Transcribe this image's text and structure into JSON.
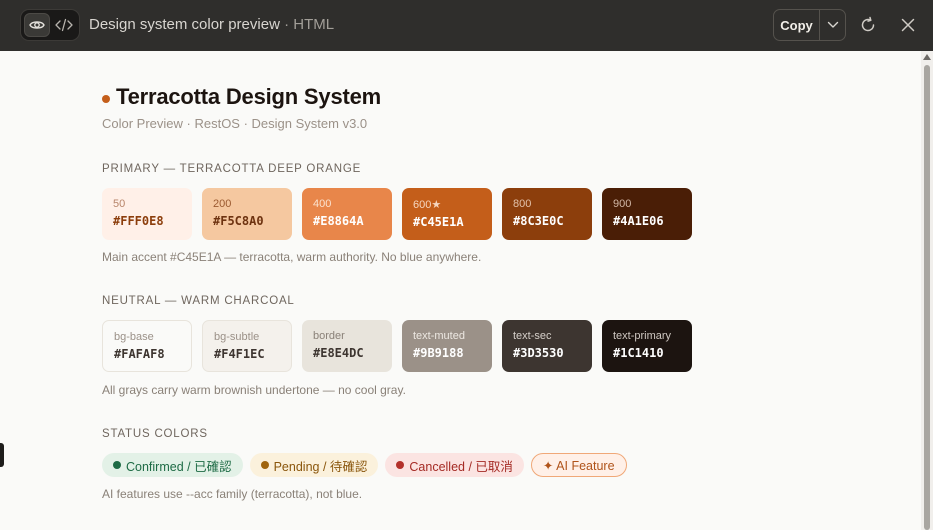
{
  "toolbar": {
    "title": "Design system color preview",
    "title_suffix": " · HTML",
    "copy_label": "Copy",
    "icons": [
      "eye-icon",
      "code-icon",
      "chevron-down-icon",
      "refresh-icon",
      "close-icon"
    ]
  },
  "page": {
    "title": "Terracotta Design System",
    "subtitle": "Color Preview · RestOS · Design System v3.0",
    "accent_color": "#C45E1A"
  },
  "primary": {
    "label": "PRIMARY — TERRACOTTA DEEP ORANGE",
    "swatches": [
      {
        "name": "50",
        "hex": "#FFF0E8"
      },
      {
        "name": "200",
        "hex": "#F5C8A0"
      },
      {
        "name": "400",
        "hex": "#E8864A"
      },
      {
        "name": "600★",
        "hex": "#C45E1A"
      },
      {
        "name": "800",
        "hex": "#8C3E0C"
      },
      {
        "name": "900",
        "hex": "#4A1E06"
      }
    ],
    "note": "Main accent #C45E1A — terracotta, warm authority. No blue anywhere."
  },
  "neutral": {
    "label": "NEUTRAL — WARM CHARCOAL",
    "swatches": [
      {
        "name": "bg-base",
        "hex": "#FAFAF8"
      },
      {
        "name": "bg-subtle",
        "hex": "#F4F1EC"
      },
      {
        "name": "border",
        "hex": "#E8E4DC"
      },
      {
        "name": "text-muted",
        "hex": "#9B9188"
      },
      {
        "name": "text-sec",
        "hex": "#3D3530"
      },
      {
        "name": "text-primary",
        "hex": "#1C1410"
      }
    ],
    "note": "All grays carry warm brownish undertone — no cool gray."
  },
  "status": {
    "label": "STATUS COLORS",
    "badges": [
      {
        "label": "Confirmed / 已確認",
        "color": "#1E6B45"
      },
      {
        "label": "Pending / 待確認",
        "color": "#A0650F"
      },
      {
        "label": "Cancelled / 已取消",
        "color": "#B3312B"
      },
      {
        "label": "✦ AI Feature",
        "color": "#C45E1A"
      }
    ],
    "note": "AI features use --acc family (terracotta), not blue."
  }
}
